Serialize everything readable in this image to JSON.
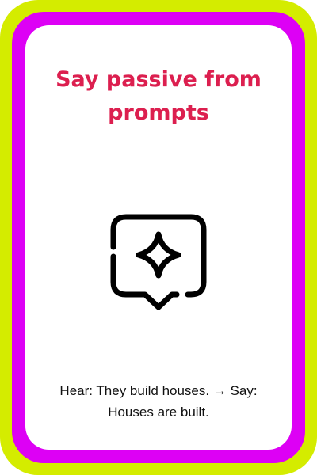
{
  "card": {
    "title": "Say passive from prompts",
    "icon": "sparkle-chat-bubble-icon",
    "prompt": "Hear: They build houses. → Say: Houses are built."
  },
  "colors": {
    "outer_border": "#d4ec00",
    "inner_border": "#dd00f5",
    "title": "#dc1f4f",
    "text": "#111111"
  }
}
